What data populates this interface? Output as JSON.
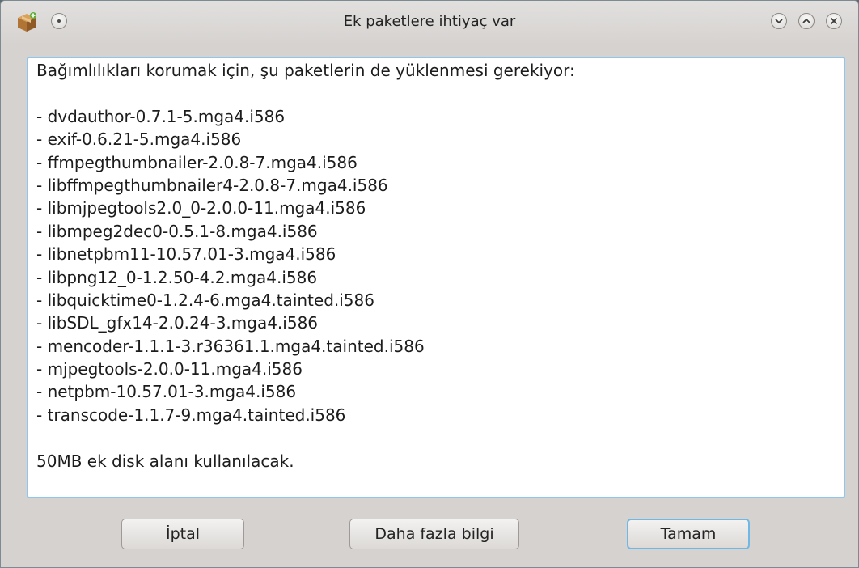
{
  "window": {
    "title": "Ek paketlere ihtiyaç var"
  },
  "message": {
    "intro": "Bağımlılıkları korumak için, şu paketlerin de yüklenmesi gerekiyor:",
    "packages": [
      "- dvdauthor-0.7.1-5.mga4.i586",
      "- exif-0.6.21-5.mga4.i586",
      "- ffmpegthumbnailer-2.0.8-7.mga4.i586",
      "- libffmpegthumbnailer4-2.0.8-7.mga4.i586",
      "- libmjpegtools2.0_0-2.0.0-11.mga4.i586",
      "- libmpeg2dec0-0.5.1-8.mga4.i586",
      "- libnetpbm11-10.57.01-3.mga4.i586",
      "- libpng12_0-1.2.50-4.2.mga4.i586",
      "- libquicktime0-1.2.4-6.mga4.tainted.i586",
      "- libSDL_gfx14-2.0.24-3.mga4.i586",
      "- mencoder-1.1.1-3.r36361.1.mga4.tainted.i586",
      "- mjpegtools-2.0.0-11.mga4.i586",
      "- netpbm-10.57.01-3.mga4.i586",
      "- transcode-1.1.7-9.mga4.tainted.i586"
    ],
    "footer": "50MB ek disk alanı kullanılacak."
  },
  "buttons": {
    "cancel": "İptal",
    "more_info": "Daha fazla bilgi",
    "ok": "Tamam"
  },
  "icons": {
    "app": "package-box-icon",
    "window_menu": "window-menu-icon",
    "minimize": "chevron-down-icon",
    "maximize": "chevron-up-icon",
    "close": "close-icon"
  },
  "colors": {
    "accent": "#6fb8e6",
    "window_bg": "#d6d2d0",
    "content_bg": "#ffffff"
  }
}
